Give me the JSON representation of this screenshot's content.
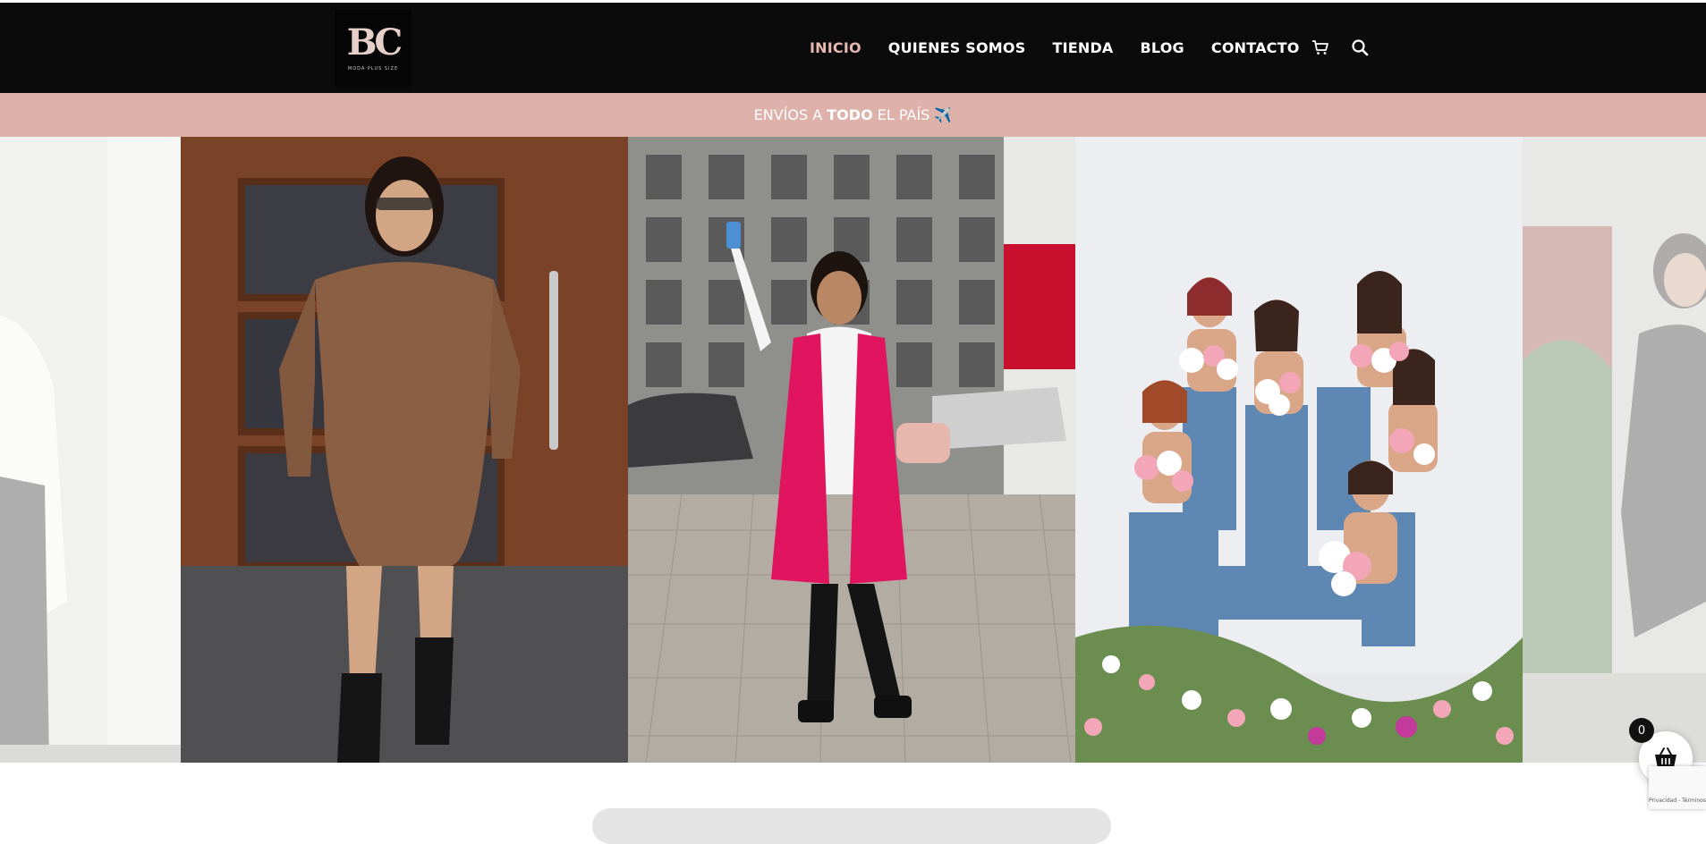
{
  "header": {
    "logo": {
      "mark": "BC",
      "sub": "MODA PLUS SIZE"
    },
    "nav": [
      {
        "label": "INICIO",
        "active": true
      },
      {
        "label": "QUIENES SOMOS",
        "active": false
      },
      {
        "label": "TIENDA",
        "active": false
      },
      {
        "label": "BLOG",
        "active": false
      },
      {
        "label": "CONTACTO",
        "active": false
      }
    ],
    "icons": [
      "cart-icon",
      "search-icon"
    ]
  },
  "banner": {
    "pre": "ENVÍOS A",
    "bold": "TODO",
    "post": "EL PAÍS",
    "emoji": "✈️"
  },
  "carousel": {
    "slides": [
      {
        "name": "slide-white-top-leather-pants",
        "faded": true
      },
      {
        "name": "slide-brown-knit-dress",
        "faded": false
      },
      {
        "name": "slide-pink-vest-selfie",
        "faded": false
      },
      {
        "name": "slide-group-flowers",
        "faded": false
      },
      {
        "name": "slide-black-dress-garden",
        "faded": true
      }
    ]
  },
  "cart_widget": {
    "count": "0"
  },
  "recaptcha": {
    "label": "Privacidad - Términos"
  },
  "colors": {
    "header_bg": "#0b0b0b",
    "accent": "#e7b8b1",
    "banner_bg": "#deb2aa"
  }
}
